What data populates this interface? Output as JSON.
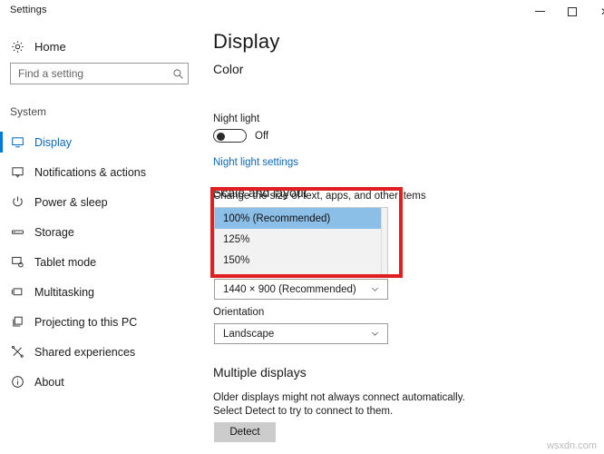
{
  "window": {
    "title": "Settings",
    "controls": {
      "minimize": "minimize-icon",
      "maximize": "maximize-icon",
      "close": "close-icon"
    }
  },
  "sidebar": {
    "home_label": "Home",
    "home_icon": "gear-icon",
    "search": {
      "placeholder": "Find a setting",
      "value": "",
      "icon": "search-icon"
    },
    "group_label": "System",
    "items": [
      {
        "label": "Display",
        "icon": "monitor-icon",
        "selected": true
      },
      {
        "label": "Notifications & actions",
        "icon": "notification-icon",
        "selected": false
      },
      {
        "label": "Power & sleep",
        "icon": "power-icon",
        "selected": false
      },
      {
        "label": "Storage",
        "icon": "drive-icon",
        "selected": false
      },
      {
        "label": "Tablet mode",
        "icon": "tablet-icon",
        "selected": false
      },
      {
        "label": "Multitasking",
        "icon": "multitasking-icon",
        "selected": false
      },
      {
        "label": "Projecting to this PC",
        "icon": "projecting-icon",
        "selected": false
      },
      {
        "label": "Shared experiences",
        "icon": "shared-icon",
        "selected": false
      },
      {
        "label": "About",
        "icon": "info-icon",
        "selected": false
      }
    ]
  },
  "main": {
    "page_title": "Display",
    "color": {
      "heading": "Color",
      "night_light_label": "Night light",
      "night_light_state": "Off",
      "night_light_settings_link": "Night light settings"
    },
    "scale_and_layout": {
      "heading": "Scale and layout",
      "scale_label": "Change the size of text, apps, and other items",
      "scale_options": [
        {
          "label": "100% (Recommended)",
          "selected": true
        },
        {
          "label": "125%",
          "selected": false
        },
        {
          "label": "150%",
          "selected": false
        }
      ],
      "resolution_value": "1440 × 900 (Recommended)",
      "orientation_label": "Orientation",
      "orientation_value": "Landscape",
      "chevron_icon": "chevron-down-icon"
    },
    "multiple_displays": {
      "heading": "Multiple displays",
      "description": "Older displays might not always connect automatically. Select Detect to try to connect to them.",
      "detect_button": "Detect"
    }
  },
  "annotation": {
    "highlight_color": "#e02020"
  },
  "watermark": "wsxdn.com"
}
